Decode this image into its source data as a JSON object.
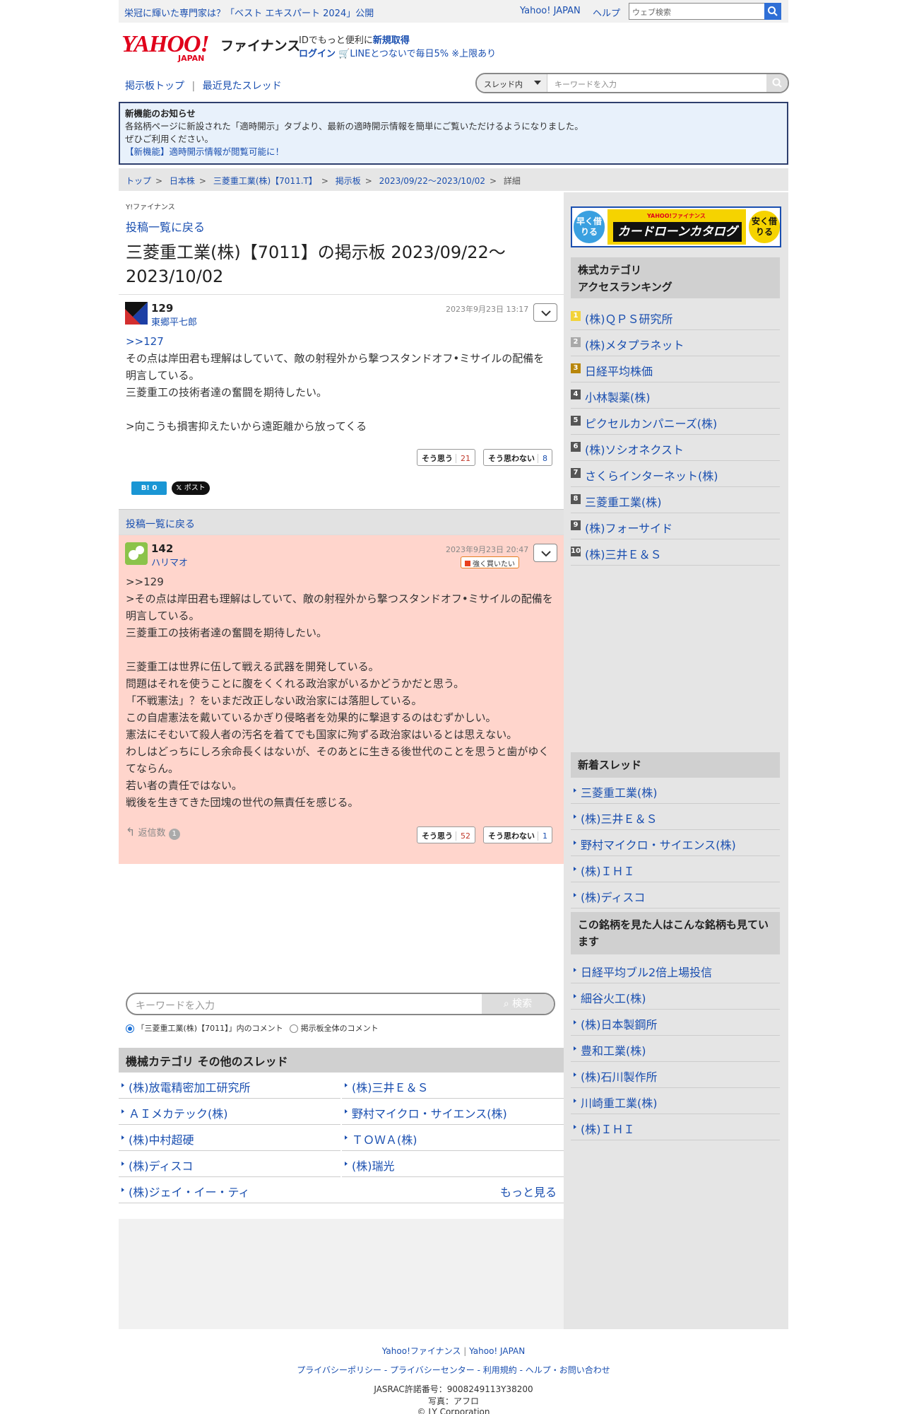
{
  "topbar": {
    "promo": "栄冠に輝いた専門家は？「ベスト エキスパート 2024」公開",
    "yahoo_japan": "Yahoo! JAPAN",
    "help": "ヘルプ",
    "search_placeholder": "ウェブ検索"
  },
  "header": {
    "logo_text": "YAHOO!",
    "logo_sub": "JAPAN",
    "finance": "ファイナンス",
    "id_line_prefix": "IDでもっと便利に",
    "id_register": "新規取得",
    "login": "ログイン",
    "line_promo": "LINEとつないで毎日5% ※上限あり"
  },
  "nav": {
    "board_top": "掲示板トップ",
    "recent": "最近見たスレッド",
    "scope": "スレッド内",
    "search_placeholder": "キーワードを入力"
  },
  "notice": {
    "title": "新機能のお知らせ",
    "line1": "各銘柄ページに新設された「適時開示」タブより、最新の適時開示情報を簡単にご覧いただけるようになりました。",
    "line2": "ぜひご利用ください。",
    "link": "【新機能】適時開示情報が閲覧可能に！"
  },
  "breadcrumb": [
    "トップ",
    "日本株",
    "三菱重工業(株)【7011.T】",
    "掲示板",
    "2023/09/22〜2023/10/02",
    "詳細"
  ],
  "main": {
    "brand": "Y!ファイナンス",
    "back_link": "投稿一覧に戻る",
    "title": "三菱重工業(株)【7011】の掲示板 2023/09/22〜2023/10/02",
    "posts": [
      {
        "num": "129",
        "author": "東郷平七郎",
        "date": "2023年9月23日 13:17",
        "reply_ref": ">>127",
        "body": "その点は岸田君も理解はしていて、敵の射程外から撃つスタンドオフ•ミサイルの配備を明言している。\n三菱重工の技術者達の奮闘を期待したい。\n\n>向こうも損害抑えたいから遠距離から放ってくる",
        "agree_label": "そう思う",
        "agree_count": "21",
        "disagree_label": "そう思わない",
        "disagree_count": "8",
        "hatena": "B! 0",
        "x_post": "ポスト"
      },
      {
        "num": "142",
        "author": "ハリマオ",
        "date": "2023年9月23日 20:47",
        "sentiment": "強く買いたい",
        "body": ">>129\n>その点は岸田君も理解はしていて、敵の射程外から撃つスタンドオフ•ミサイルの配備を明言している。\n三菱重工の技術者達の奮闘を期待したい。\n\n三菱重工は世界に伍して戦える武器を開発している。\n問題はそれを使うことに腹をくくれる政治家がいるかどうかだと思う。\n「不戦憲法」？をいまだ改正しない政治家には落胆している。\nこの自虐憲法を戴いているかぎり侵略者を効果的に撃退するのはむずかしい。\n憲法にそむいて殺人者の汚名を着てでも国家に殉ずる政治家はいるとは思えない。\nわしはどっちにしろ余命長くはないが、そのあとに生きる後世代のことを思うと歯がゆくてならん。\n若い者の責任ではない。\n戦後を生きてきた団塊の世代の無責任を感じる。",
        "reply_label": "返信数",
        "reply_count": "1",
        "agree_label": "そう思う",
        "agree_count": "52",
        "disagree_label": "そう思わない",
        "disagree_count": "1"
      }
    ],
    "search_placeholder": "キーワードを入力",
    "search_button": "検索",
    "radio_thread": "「三菱重工業(株)【7011】」内のコメント",
    "radio_all": "掲示板全体のコメント",
    "category_title": "機械カテゴリ その他のスレッド",
    "category_left": [
      "(株)放電精密加工研究所",
      "ＡＩメカテック(株)",
      "(株)中村超硬",
      "(株)ディスコ",
      "(株)ジェイ・イー・ティ"
    ],
    "category_right": [
      "(株)三井Ｅ＆Ｓ",
      "野村マイクロ・サイエンス(株)",
      "ＴＯＷＡ(株)",
      "(株)瑞光"
    ],
    "more": "もっと見る"
  },
  "sidebar": {
    "ad_left": "早く借りる",
    "ad_center": "カードローンカタログ",
    "ad_brand": "YAHOO!ファイナンス",
    "ad_right": "安く借りる",
    "ranking_title": "株式カテゴリ\nアクセスランキング",
    "ranking": [
      {
        "rank": "1",
        "name": "(株)ＱＰＳ研究所",
        "color": "#f2d33a"
      },
      {
        "rank": "2",
        "name": "(株)メタプラネット",
        "color": "#a9a9a9"
      },
      {
        "rank": "3",
        "name": "日経平均株価",
        "color": "#b8860b"
      },
      {
        "rank": "4",
        "name": "小林製薬(株)",
        "color": "#555555"
      },
      {
        "rank": "5",
        "name": "ピクセルカンパニーズ(株)",
        "color": "#555555"
      },
      {
        "rank": "6",
        "name": "(株)ソシオネクスト",
        "color": "#555555"
      },
      {
        "rank": "7",
        "name": "さくらインターネット(株)",
        "color": "#555555"
      },
      {
        "rank": "8",
        "name": "三菱重工業(株)",
        "color": "#555555"
      },
      {
        "rank": "9",
        "name": "(株)フォーサイド",
        "color": "#555555"
      },
      {
        "rank": "10",
        "name": "(株)三井Ｅ＆Ｓ",
        "color": "#555555"
      }
    ],
    "new_threads_title": "新着スレッド",
    "new_threads": [
      "三菱重工業(株)",
      "(株)三井Ｅ＆Ｓ",
      "野村マイクロ・サイエンス(株)",
      "(株)ＩＨＩ",
      "(株)ディスコ"
    ],
    "also_viewed_title": "この銘柄を見た人はこんな銘柄も見ています",
    "also_viewed": [
      "日経平均ブル2倍上場投信",
      "細谷火工(株)",
      "(株)日本製鋼所",
      "豊和工業(株)",
      "(株)石川製作所",
      "川崎重工業(株)",
      "(株)ＩＨＩ"
    ]
  },
  "footer": {
    "yf": "Yahoo!ファイナンス",
    "yj": "Yahoo! JAPAN",
    "privacy_policy": "プライバシーポリシー",
    "privacy_center": "プライバシーセンター",
    "terms": "利用規約",
    "help": "ヘルプ・お問い合わせ",
    "jasrac": "JASRAC許諾番号：9008249113Y38200",
    "photo": "写真：アフロ",
    "copyright": "© LY Corporation"
  }
}
